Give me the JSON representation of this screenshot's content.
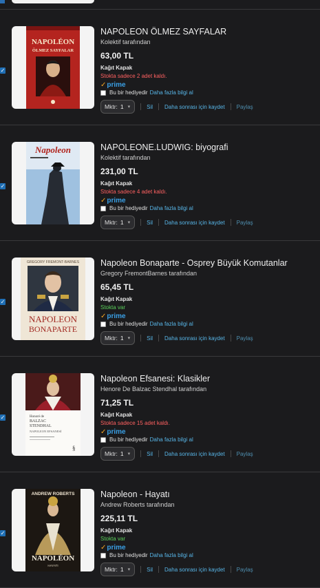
{
  "items": [
    {
      "title": "NAPOLEON ÖLMEZ SAYFALAR",
      "author": "Kolektif tarafından",
      "price": "63,00 TL",
      "format": "Kağıt Kapak",
      "stock": "Stokta sadece 2 adet kaldı.",
      "stock_status": "low",
      "cover_text": [
        "NAPOLÉON",
        "ÖLMEZ SAYFALAR"
      ]
    },
    {
      "title": "NAPOLEONE.LUDWIG: biyografi",
      "author": "Kolektif tarafından",
      "price": "231,00 TL",
      "format": "Kağıt Kapak",
      "stock": "Stokta sadece 4 adet kaldı.",
      "stock_status": "low",
      "cover_text": [
        "Napoleon"
      ]
    },
    {
      "title": "Napoleon Bonaparte - Osprey Büyük Komutanlar",
      "author": "Gregory FremontBarnes tarafından",
      "price": "65,45 TL",
      "format": "Kağıt Kapak",
      "stock": "Stokta var",
      "stock_status": "ok",
      "cover_text": [
        "GREGORY FREMONT-BARNES",
        "NAPOLEON",
        "BONAPARTE"
      ]
    },
    {
      "title": "Napoleon Efsanesi: Klasikler",
      "author": "Henore De Balzac Stendhal tarafından",
      "price": "71,25 TL",
      "format": "Kağıt Kapak",
      "stock": "Stokta sadece 15 adet kaldı.",
      "stock_status": "low",
      "cover_text": [
        "Honoré de",
        "BALZAC",
        "STENDHAL",
        "NAPOLEON EFSANESİ"
      ]
    },
    {
      "title": "Napoleon - Hayatı",
      "author": "Andrew Roberts tarafından",
      "price": "225,11 TL",
      "format": "Kağıt Kapak",
      "stock": "Stokta var",
      "stock_status": "ok",
      "cover_text": [
        "ANDREW ROBERTS",
        "NAPOLÉON",
        "HAYATI"
      ]
    }
  ],
  "labels": {
    "prime": "prime",
    "gift": "Bu bir hediyedir",
    "gift_more": "Daha fazla bilgi al",
    "qty_label": "Mktr:",
    "qty_value": "1",
    "delete": "Sil",
    "save_later": "Daha sonrası için kaydet",
    "share": "Paylaş"
  },
  "colors": {
    "background": "#1b1b1d",
    "link": "#58b6e8",
    "stock_low": "#ff6161",
    "stock_ok": "#5bd15b",
    "prime": "#3aa0e6",
    "prime_check": "#f4a522"
  }
}
